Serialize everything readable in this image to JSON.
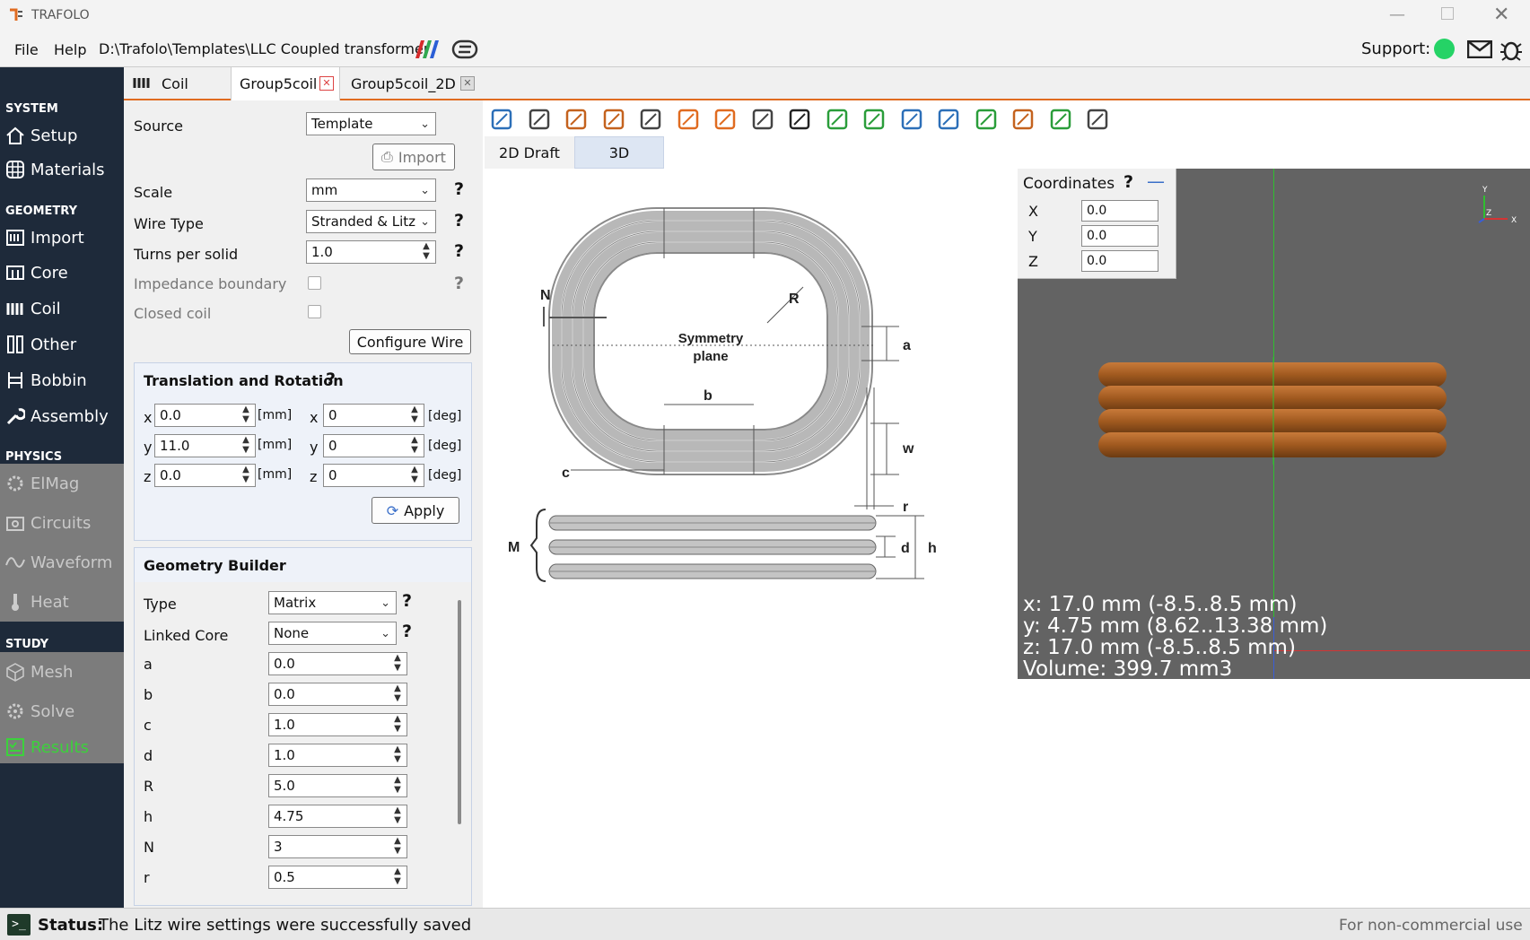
{
  "app": {
    "title": "TRAFOLO",
    "path": "D:\\Trafolo\\Templates\\LLC Coupled transformer"
  },
  "menu": {
    "file": "File",
    "help": "Help",
    "support": "Support:"
  },
  "sidebar": {
    "sections": {
      "system": "SYSTEM",
      "geometry": "GEOMETRY",
      "physics": "PHYSICS",
      "study": "STUDY"
    },
    "items": {
      "setup": "Setup",
      "materials": "Materials",
      "import": "Import",
      "core": "Core",
      "coil": "Coil",
      "other": "Other",
      "bobbin": "Bobbin",
      "assembly": "Assembly",
      "elmag": "ElMag",
      "circuits": "Circuits",
      "waveform": "Waveform",
      "heat": "Heat",
      "mesh": "Mesh",
      "solve": "Solve",
      "results": "Results"
    }
  },
  "tabs": {
    "coil": "Coil",
    "group5coil": "Group5coil",
    "group5coil_2d": "Group5coil_2D"
  },
  "form": {
    "source_label": "Source",
    "source_value": "Template",
    "import_label": "Import",
    "scale_label": "Scale",
    "scale_value": "mm",
    "wire_label": "Wire Type",
    "wire_value": "Stranded & Litz",
    "turns_label": "Turns per solid",
    "turns_value": "1.0",
    "impedance_label": "Impedance boundary",
    "closed_label": "Closed coil",
    "configure_wire": "Configure Wire",
    "q": "?"
  },
  "transrot": {
    "title": "Translation and Rotation",
    "x": "x",
    "y": "y",
    "z": "z",
    "mm": "[mm]",
    "deg": "[deg]",
    "tx": "0.0",
    "ty": "11.0",
    "tz": "0.0",
    "rx": "0",
    "ry": "0",
    "rz": "0",
    "apply": "Apply"
  },
  "geom": {
    "title": "Geometry Builder",
    "type_label": "Type",
    "type_value": "Matrix",
    "core_label": "Linked Core",
    "core_value": "None",
    "params": [
      {
        "label": "a",
        "value": "0.0"
      },
      {
        "label": "b",
        "value": "0.0"
      },
      {
        "label": "c",
        "value": "1.0"
      },
      {
        "label": "d",
        "value": "1.0"
      },
      {
        "label": "R",
        "value": "5.0"
      },
      {
        "label": "h",
        "value": "4.75"
      },
      {
        "label": "N",
        "value": "3"
      },
      {
        "label": "r",
        "value": "0.5"
      }
    ]
  },
  "view": {
    "tab_2d": "2D Draft",
    "tab_3d": "3D"
  },
  "diagram": {
    "N": "N",
    "R": "R",
    "sym1": "Symmetry",
    "sym2": "plane",
    "a": "a",
    "b": "b",
    "w": "w",
    "c": "c",
    "r": "r",
    "M": "M",
    "d": "d",
    "h": "h"
  },
  "coords": {
    "title": "Coordinates",
    "X": "X",
    "Y": "Y",
    "Z": "Z",
    "xv": "0.0",
    "yv": "0.0",
    "zv": "0.0"
  },
  "axis": {
    "y": "Y",
    "z": "Z",
    "x": "X"
  },
  "dims": {
    "x": "x: 17.0 mm (-8.5..8.5 mm)",
    "y": "y: 4.75 mm (8.62..13.38 mm)",
    "z": "z: 17.0 mm (-8.5..8.5 mm)",
    "vol": "Volume: 399.7 mm3"
  },
  "status": {
    "label": "Status:",
    "message": "The Litz wire settings were successfully saved",
    "license": "For non-commercial use"
  },
  "colors": {
    "accent": "#e06b20",
    "sidebar": "#1e2a3a",
    "coil": "#a0591f",
    "viewport": "#636363",
    "results": "#3cd13c"
  }
}
